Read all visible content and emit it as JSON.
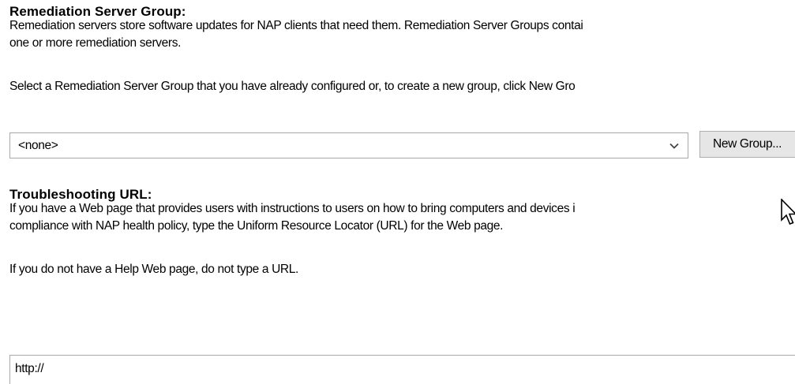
{
  "remediation": {
    "heading": "Remediation Server Group:",
    "description_line1": "Remediation servers store software updates for NAP clients that need them. Remediation Server Groups contai",
    "description_line2": "one or more remediation servers.",
    "instruction": "Select a Remediation Server Group that you have already configured or, to create a new group, click New Gro",
    "group_select_value": "<none>",
    "new_group_button_label": "New Group..."
  },
  "troubleshooting": {
    "heading": "Troubleshooting URL:",
    "description_line1": "If you have a Web page that provides users with instructions to users on how to bring computers and devices i",
    "description_line2": "compliance with NAP health policy, type the Uniform Resource Locator (URL) for the Web page.",
    "note": "If you do not have a Help Web page, do not type a URL.",
    "url_value": "http://"
  },
  "icons": {
    "dropdown": "chevron-down-icon",
    "cursor": "mouse-pointer-icon"
  },
  "colors": {
    "border": "#a8a8a8",
    "button_bg": "#e6e6e6"
  }
}
